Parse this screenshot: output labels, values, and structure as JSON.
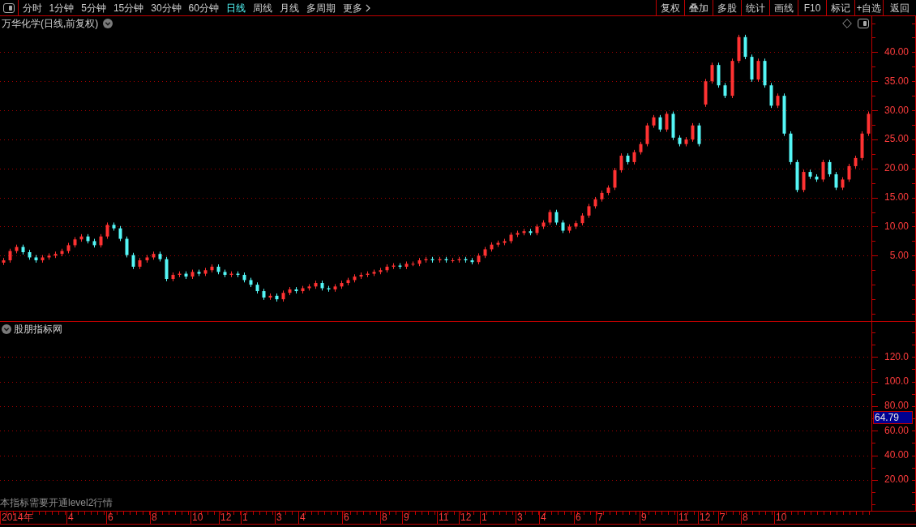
{
  "toolbar": {
    "periods": [
      {
        "label": "分时",
        "selected": false
      },
      {
        "label": "1分钟",
        "selected": false
      },
      {
        "label": "5分钟",
        "selected": false
      },
      {
        "label": "15分钟",
        "selected": false
      },
      {
        "label": "30分钟",
        "selected": false
      },
      {
        "label": "60分钟",
        "selected": false
      },
      {
        "label": "日线",
        "selected": true
      },
      {
        "label": "周线",
        "selected": false
      },
      {
        "label": "月线",
        "selected": false
      },
      {
        "label": "多周期",
        "selected": false
      }
    ],
    "more": {
      "label": "更多"
    },
    "actions": [
      "复权",
      "叠加",
      "多股",
      "统计",
      "画线",
      "F10",
      "标记",
      "+自选",
      "返回"
    ]
  },
  "main_chart": {
    "title": "万华化学(日线,前复权)",
    "price_axis_labels": [
      "40.00",
      "35.00",
      "30.00",
      "25.00",
      "20.00",
      "15.00",
      "10.00",
      "5.00"
    ]
  },
  "indicator_pane": {
    "title": "股朋指标网",
    "axis_labels": [
      "120.0",
      "100.0",
      "80.00",
      "60.00",
      "40.00",
      "20.00"
    ],
    "current_value": "64.79",
    "notice": "本指标需要开通level2行情"
  },
  "date_axis": [
    "2014年",
    "4",
    "6",
    "8",
    "10",
    "12",
    "1",
    "3",
    "4",
    "6",
    "8",
    "9",
    "11",
    "12",
    "1",
    "3",
    "4",
    "6",
    "7",
    "9",
    "11",
    "12",
    "7",
    "8",
    "10"
  ]
}
